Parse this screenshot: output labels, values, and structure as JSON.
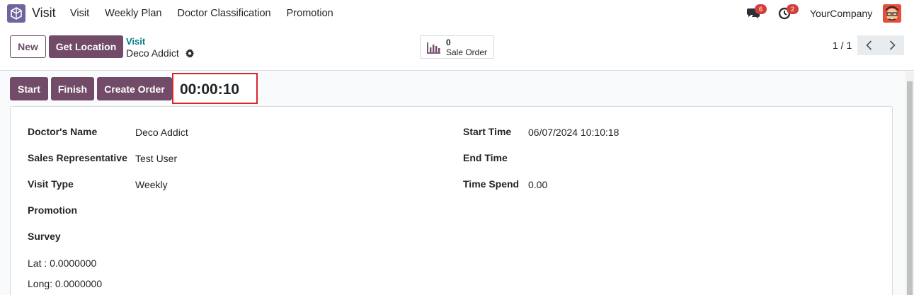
{
  "navbar": {
    "app_name": "Visit",
    "menu": [
      "Visit",
      "Weekly Plan",
      "Doctor Classification",
      "Promotion"
    ],
    "messages_count": "6",
    "activities_count": "2",
    "company": "YourCompany"
  },
  "control_panel": {
    "new_label": "New",
    "get_location_label": "Get Location",
    "breadcrumb": "Visit",
    "record_name": "Deco Addict",
    "smart_button": {
      "value": "0",
      "label": "Sale Order"
    },
    "pager": "1 / 1"
  },
  "status_bar": {
    "start_label": "Start",
    "finish_label": "Finish",
    "create_order_label": "Create Order",
    "timer": "00:00:10"
  },
  "form": {
    "doctor_name_label": "Doctor's Name",
    "doctor_name": "Deco Addict",
    "sales_rep_label": "Sales Representative",
    "sales_rep": "Test User",
    "visit_type_label": "Visit Type",
    "visit_type": "Weekly",
    "promotion_label": "Promotion",
    "survey_label": "Survey",
    "lat": "Lat : 0.0000000",
    "long": "Long: 0.0000000",
    "start_time_label": "Start Time",
    "start_time": "06/07/2024 10:10:18",
    "end_time_label": "End Time",
    "time_spend_label": "Time Spend",
    "time_spend": "0.00"
  },
  "colors": {
    "primary": "#714b67",
    "link": "#017e84",
    "badge": "#d23f3a",
    "highlight_border": "#d7262d"
  },
  "icons": [
    "visit-app-icon",
    "chat-icon",
    "activity-clock-icon",
    "gear-icon",
    "bar-chart-icon",
    "chevron-left-icon",
    "chevron-right-icon"
  ]
}
